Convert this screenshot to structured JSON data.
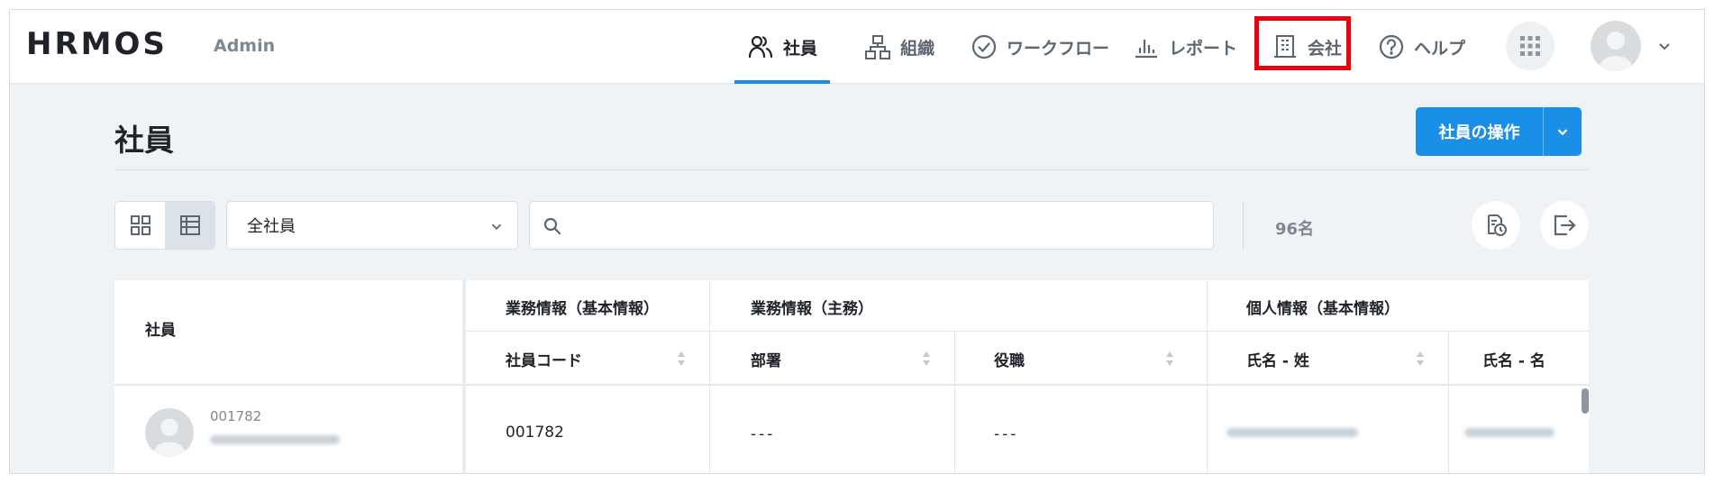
{
  "header": {
    "logo": "HRMOS",
    "admin_label": "Admin",
    "nav": [
      {
        "label": "社員",
        "icon": "people-icon",
        "active": true
      },
      {
        "label": "組織",
        "icon": "org-chart-icon",
        "active": false
      },
      {
        "label": "ワークフロー",
        "icon": "check-circle-icon",
        "active": false
      },
      {
        "label": "レポート",
        "icon": "bar-chart-icon",
        "active": false
      },
      {
        "label": "会社",
        "icon": "building-icon",
        "active": false,
        "highlighted": true
      },
      {
        "label": "ヘルプ",
        "icon": "help-circle-icon",
        "active": false
      }
    ],
    "highlight_color": "#e8000e",
    "accent_color": "#1a8fe7"
  },
  "page": {
    "title": "社員",
    "ops_button": "社員の操作"
  },
  "toolbar": {
    "selected_filter": "全社員",
    "search_placeholder": "",
    "count": "96名",
    "view_mode": "table"
  },
  "table": {
    "employee_col": "社員",
    "groups": [
      "業務情報（基本情報）",
      "業務情報（主務）",
      "個人情報（基本情報）"
    ],
    "columns": [
      "社員コード",
      "部署",
      "役職",
      "氏名 - 姓",
      "氏名 - 名"
    ],
    "rows": [
      {
        "code_small": "001782",
        "code": "001782",
        "department": "---",
        "position": "---"
      }
    ]
  }
}
